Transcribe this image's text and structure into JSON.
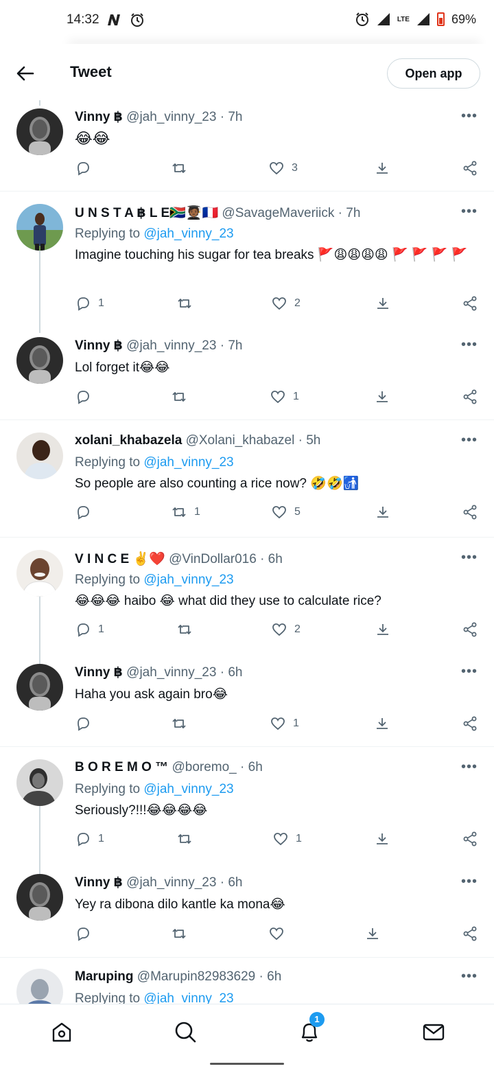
{
  "status_bar": {
    "time": "14:32",
    "battery": "69%",
    "network": "LTE",
    "left_icons": [
      "n-icon",
      "alarm-icon"
    ],
    "right_icons": [
      "alarm-icon",
      "signal-icon",
      "signal-icon",
      "battery-icon"
    ]
  },
  "header": {
    "title": "Tweet",
    "open_app": "Open app"
  },
  "tweets": [
    {
      "name": "Vinny ฿",
      "handle": "@jah_vinny_23",
      "time": "· 7h",
      "replying": "",
      "reply_tag": "",
      "text": "😂😂",
      "replies": "",
      "retweets": "",
      "likes": "3"
    },
    {
      "name": "U N S T A ฿ L E🇿🇦🧑🏾‍🎓🇫🇷",
      "handle": "@SavageMaveriick",
      "time": "· 7h",
      "replying": "Replying to ",
      "reply_tag": "@jah_vinny_23",
      "text": "Imagine touching his sugar for tea breaks 🚩😩😩😩😩 🚩 🚩 🚩 🚩",
      "replies": "1",
      "retweets": "",
      "likes": "2"
    },
    {
      "name": "Vinny ฿",
      "handle": "@jah_vinny_23",
      "time": "· 7h",
      "replying": "",
      "reply_tag": "",
      "text": "Lol forget it😂😂",
      "replies": "",
      "retweets": "",
      "likes": "1"
    },
    {
      "name": "xolani_khabazela",
      "handle": "@Xolani_khabazel",
      "time": "· 5h",
      "replying": "Replying to ",
      "reply_tag": "@jah_vinny_23",
      "text": "So people are also counting a rice now? 🤣🤣🚮",
      "replies": "",
      "retweets": "1",
      "likes": "5"
    },
    {
      "name": "V I N C E ✌️❤️",
      "handle": "@VinDollar016",
      "time": "· 6h",
      "replying": "Replying to ",
      "reply_tag": "@jah_vinny_23",
      "text": "😂😂😂 haibo 😂 what did they use to calculate  rice?",
      "replies": "1",
      "retweets": "",
      "likes": "2"
    },
    {
      "name": "Vinny ฿",
      "handle": "@jah_vinny_23",
      "time": "· 6h",
      "replying": "",
      "reply_tag": "",
      "text": "Haha you ask again bro😂",
      "replies": "",
      "retweets": "",
      "likes": "1"
    },
    {
      "name": "B O R E M O ™",
      "handle": "@boremo_",
      "time": "· 6h",
      "replying": "Replying to ",
      "reply_tag": "@jah_vinny_23",
      "text": "Seriously?!!!😂😂😂😂",
      "replies": "1",
      "retweets": "",
      "likes": "1"
    },
    {
      "name": "Vinny ฿",
      "handle": "@jah_vinny_23",
      "time": "· 6h",
      "replying": "",
      "reply_tag": "",
      "text": "Yey ra dibona dilo kantle ka mona😂",
      "replies": "",
      "retweets": "",
      "likes": ""
    },
    {
      "name": "Maruping",
      "handle": "@Marupin82983629",
      "time": "· 6h",
      "replying": "Replying to ",
      "reply_tag": "@jah_vinny_23",
      "text": "",
      "replies": "",
      "retweets": "",
      "likes": ""
    }
  ],
  "more_label": "•••",
  "bottom_nav": {
    "items": [
      "home-icon",
      "search-icon",
      "notifications-icon",
      "messages-icon"
    ],
    "notification_count": "1"
  },
  "colors": {
    "accent": "#1d9bf0",
    "muted": "#536471",
    "text": "#0f1419"
  }
}
